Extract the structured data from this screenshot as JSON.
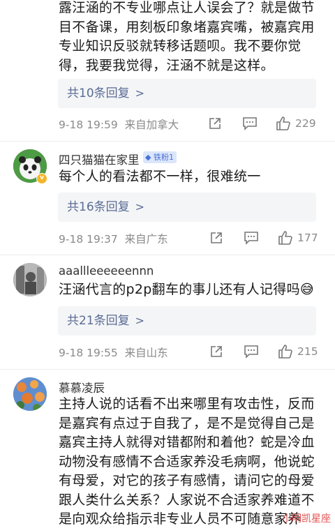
{
  "comments": [
    {
      "text_lines": [
        "露汪涵的不专业哪点让人误会了？就是做节",
        "目不备课，用刻板印象堵嘉宾嘴，被嘉宾用",
        "专业知识反驳就转移话题呗。我不要你觉",
        "得，我要我觉得，汪涵不就是这样。"
      ],
      "reply_label": "共10条回复",
      "time": "9-18 19:59",
      "source": "来自加拿大",
      "likes": "229"
    },
    {
      "username": "四只猫猫在家里",
      "fan_badge": "铁粉1",
      "text_lines": [
        "每个人的看法都不一样，很难统一"
      ],
      "reply_label": "共16条回复",
      "time": "9-18 19:37",
      "source": "来自广东",
      "likes": "177"
    },
    {
      "username": "aaallleeeeeennn",
      "text_lines": [
        "汪涵代言的p2p翻车的事儿还有人记得吗"
      ],
      "emoji": "😅",
      "reply_label": "共21条回复",
      "time": "9-18 19:55",
      "source": "来自山东",
      "likes": "215"
    },
    {
      "username": "慕慕凌辰",
      "text_lines": [
        "主持人说的话看不出来哪里有攻击性，反而",
        "是嘉宾有点过于自我了，是不是觉得自己是",
        "嘉宾主持人就得对错都附和着他？蛇是冷血",
        "动物没有感情不合适家养没毛病啊，他说蛇",
        "有母爱，对它的孩子有感情，请问它的母爱",
        "跟人类什么关系？人家说不合适家养难道不",
        "是向观众给指示非专业人员不可随意家养"
      ]
    }
  ],
  "watermark": "小明凯星座",
  "colors": {
    "link": "#5a6c94",
    "meta": "#8a8a8a",
    "badge_bg": "#dbe6fb",
    "badge_fg": "#4a6fd6"
  }
}
